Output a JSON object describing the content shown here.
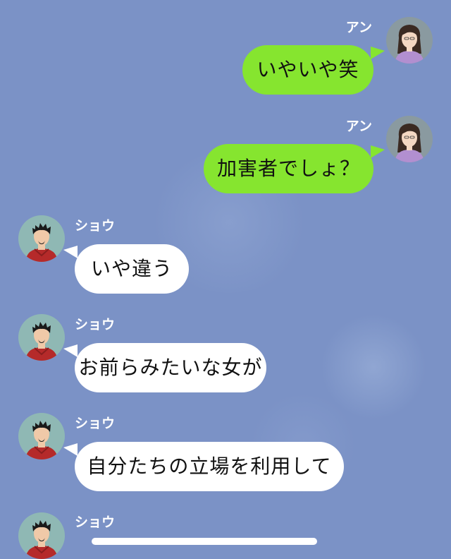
{
  "chat": {
    "messages": [
      {
        "sender": "アン",
        "side": "right",
        "text": "いやいや笑"
      },
      {
        "sender": "アン",
        "side": "right",
        "text": "加害者でしょ？"
      },
      {
        "sender": "ショウ",
        "side": "left",
        "text": "いや違う"
      },
      {
        "sender": "ショウ",
        "side": "left",
        "text": "お前らみたいな女が"
      },
      {
        "sender": "ショウ",
        "side": "left",
        "text": "自分たちの立場を利用して"
      },
      {
        "sender": "ショウ",
        "side": "left",
        "text": ""
      }
    ]
  },
  "colors": {
    "background": "#7b92c6",
    "sent_bubble": "#86e52f",
    "received_bubble": "#ffffff",
    "name_text": "#ffffff"
  },
  "icons": {
    "female_avatar": "female-avatar-icon",
    "male_avatar": "male-avatar-icon"
  }
}
